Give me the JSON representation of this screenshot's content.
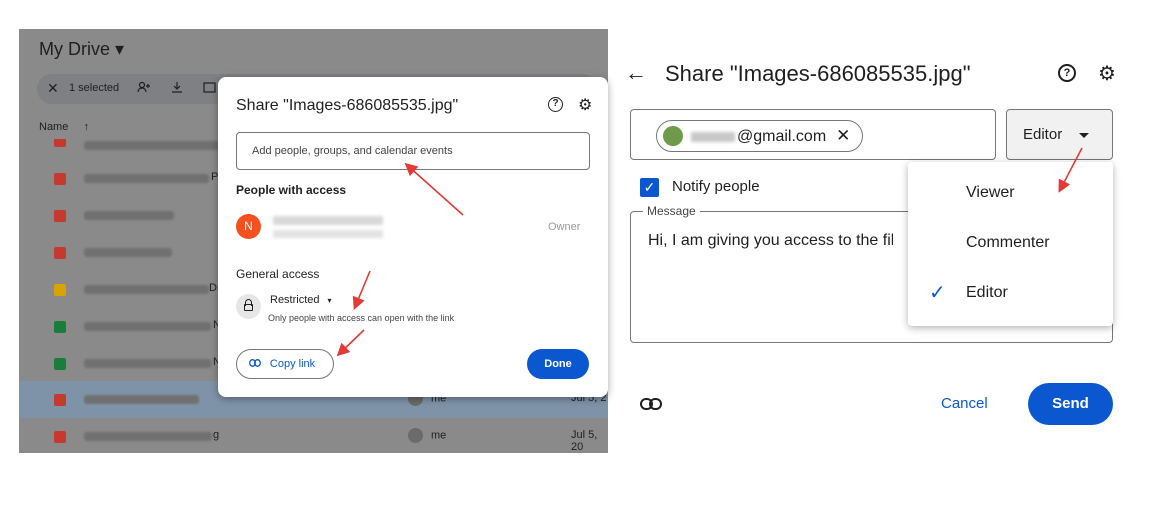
{
  "drive": {
    "title": "My Drive",
    "caret": "▾",
    "selection_bar": {
      "close": "✕",
      "selected_count": "1 selected"
    },
    "name_header": "Name",
    "sort_arrow": "↑",
    "rows": [
      {
        "icon_color": "#d93025",
        "tail": "",
        "owner": "",
        "date": ""
      },
      {
        "icon_color": "#d93025",
        "tail": "P",
        "owner": "",
        "date": ""
      },
      {
        "icon_color": "#d93025",
        "tail": "",
        "owner": "",
        "date": ""
      },
      {
        "icon_color": "#d93025",
        "tail": "",
        "owner": "",
        "date": ""
      },
      {
        "icon_color": "#f4b400",
        "tail": "Dr",
        "owner": "",
        "date": ""
      },
      {
        "icon_color": "#188038",
        "tail": "N",
        "owner": "",
        "date": ""
      },
      {
        "icon_color": "#188038",
        "tail": "N",
        "owner": "",
        "date": ""
      },
      {
        "icon_color": "#d93025",
        "tail": "",
        "owner": "me",
        "date": "Jul 5, 2"
      },
      {
        "icon_color": "#d93025",
        "tail": "g",
        "owner": "me",
        "date": "Jul 5, 20"
      }
    ]
  },
  "share_dialog": {
    "title": "Share \"Images-686085535.jpg\"",
    "help_icon": "?",
    "settings_icon": "⚙",
    "add_placeholder": "Add people, groups, and calendar events",
    "people_with_access": "People with access",
    "owner_initial": "N",
    "owner_role": "Owner",
    "general_access": "General access",
    "access_level": "Restricted",
    "access_caret": "▾",
    "access_description": "Only people with access can open with the link",
    "copy_link": "Copy link",
    "copy_link_icon": "⊖",
    "done": "Done"
  },
  "share_dialog_large": {
    "back_icon": "←",
    "title": "Share \"Images-686085535.jpg\"",
    "help_icon": "?",
    "settings_icon": "⚙",
    "chip_email": "@gmail.com",
    "chip_remove": "✕",
    "role": "Editor",
    "notify_checked": "✓",
    "notify_label": "Notify people",
    "message_label": "Message",
    "message_text": "Hi, I am giving you access to the fil",
    "role_menu": [
      {
        "label": "Viewer",
        "selected": false
      },
      {
        "label": "Commenter",
        "selected": false
      },
      {
        "label": "Editor",
        "selected": true
      }
    ],
    "check_icon": "✓",
    "link_icon": "⊖",
    "cancel": "Cancel",
    "send": "Send"
  },
  "colors": {
    "accent": "#0b57d0",
    "annotation_arrow": "#e53935"
  }
}
